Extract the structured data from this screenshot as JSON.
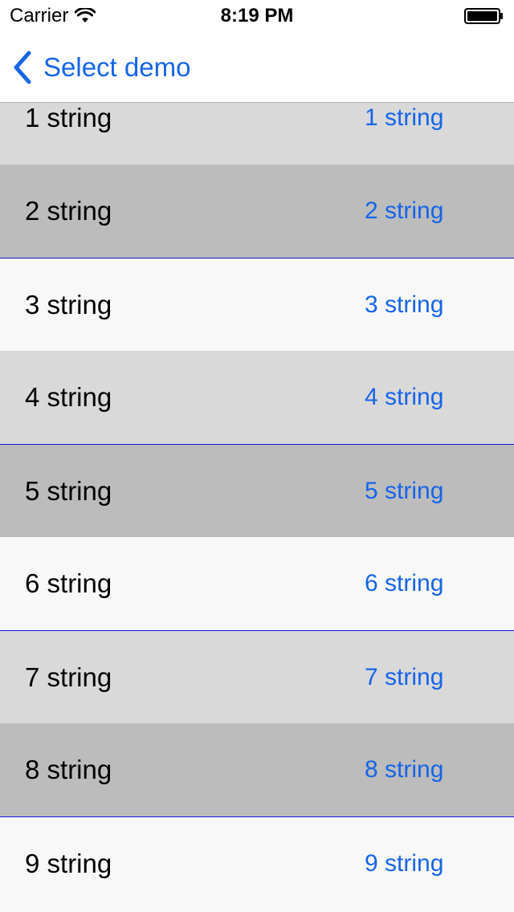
{
  "status_bar": {
    "carrier": "Carrier",
    "time": "8:19 PM",
    "wifi_icon": "wifi-icon",
    "battery_icon": "battery-icon"
  },
  "nav": {
    "back_label": "Select demo",
    "back_icon": "chevron-left-icon"
  },
  "colors": {
    "accent": "#1565e8",
    "row_light": "#d9d9d9",
    "row_dark": "#bcbcbc",
    "row_white": "#f8f8f8",
    "separator": "#1414e0"
  },
  "rows": [
    {
      "left": "1 string",
      "right": "1 string"
    },
    {
      "left": "2 string",
      "right": "2 string"
    },
    {
      "left": "3 string",
      "right": "3 string"
    },
    {
      "left": "4 string",
      "right": "4 string"
    },
    {
      "left": "5 string",
      "right": "5 string"
    },
    {
      "left": "6 string",
      "right": "6 string"
    },
    {
      "left": "7 string",
      "right": "7 string"
    },
    {
      "left": "8 string",
      "right": "8 string"
    },
    {
      "left": "9 string",
      "right": "9 string"
    }
  ]
}
